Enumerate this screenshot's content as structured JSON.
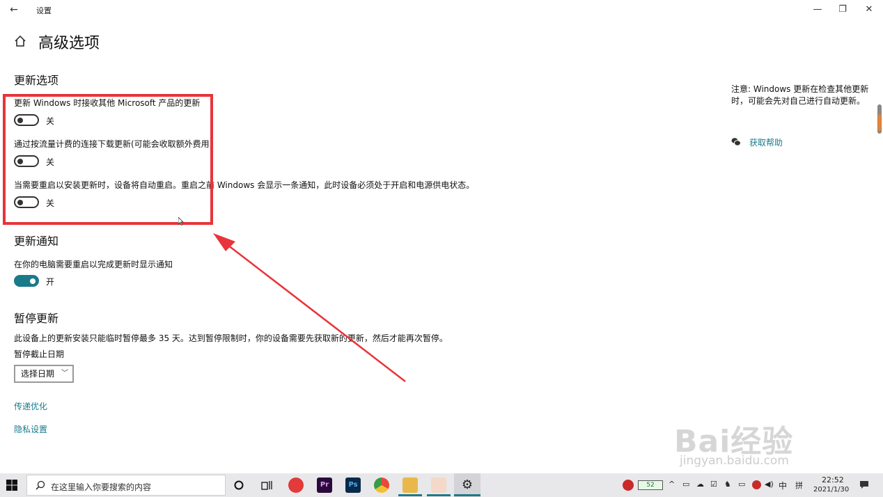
{
  "window": {
    "title": "设置",
    "back_glyph": "←",
    "minimize_glyph": "—",
    "maximize_glyph": "❐",
    "close_glyph": "✕"
  },
  "page": {
    "title": "高级选项"
  },
  "update_options": {
    "heading": "更新选项",
    "items": [
      {
        "label": "更新 Windows 时接收其他 Microsoft 产品的更新",
        "state": "关",
        "on": false
      },
      {
        "label": "通过按流量计费的连接下载更新(可能会收取额外费用)",
        "state": "关",
        "on": false
      },
      {
        "label": "当需要重启以安装更新时，设备将自动重启。重启之前 Windows 会显示一条通知，此时设备必须处于开启和电源供电状态。",
        "state": "关",
        "on": false
      }
    ]
  },
  "update_notify": {
    "heading": "更新通知",
    "label": "在你的电脑需要重启以完成更新时显示通知",
    "state": "开",
    "on": true
  },
  "pause": {
    "heading": "暂停更新",
    "description": "此设备上的更新安装只能临时暂停最多 35 天。达到暂停限制时，你的设备需要先获取新的更新，然后才能再次暂停。",
    "date_label": "暂停截止日期",
    "select_value": "选择日期"
  },
  "links": {
    "delivery": "传递优化",
    "privacy": "隐私设置"
  },
  "sidebar": {
    "note": "注意: Windows 更新在检查其他更新时，可能会先对自己进行自动更新。",
    "help": "获取帮助"
  },
  "watermark": {
    "brand": "Bai经验",
    "sub": "jingyan.baidu.com"
  },
  "taskbar": {
    "search_placeholder": "在这里输入你要搜索的内容",
    "apps": [
      {
        "name": "netease-music-icon",
        "label": "",
        "color": "#e33a3a"
      },
      {
        "name": "premiere-icon",
        "label": "Pr",
        "color": "#2a0a3a"
      },
      {
        "name": "photoshop-icon",
        "label": "Ps",
        "color": "#0a2a4a"
      },
      {
        "name": "chrome-icon",
        "label": "",
        "color": "#3a9a4a"
      },
      {
        "name": "file-explorer-icon",
        "label": "",
        "color": "#e8b84a"
      },
      {
        "name": "ppt-app-icon",
        "label": "",
        "color": "#e86a3a"
      },
      {
        "name": "settings-app-icon",
        "label": "⚙",
        "color": "#555555"
      }
    ],
    "battery": "52",
    "ime": "中",
    "keyboard": "拼",
    "time": "22:52",
    "date": "2021/1/30"
  }
}
